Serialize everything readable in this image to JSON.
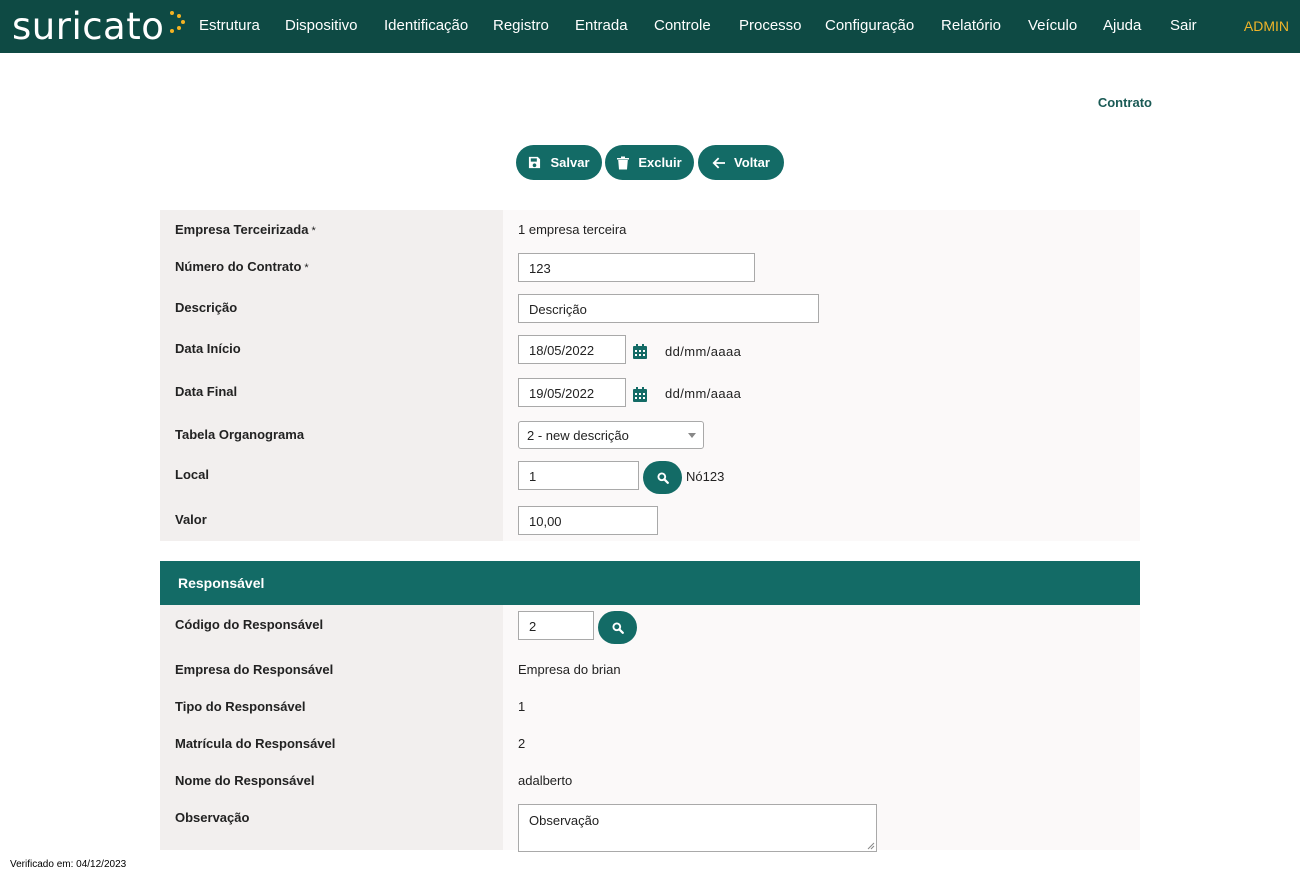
{
  "brand": {
    "logo_text": "suricato"
  },
  "nav": {
    "items": [
      "Estrutura",
      "Dispositivo",
      "Identificação",
      "Registro",
      "Entrada",
      "Controle",
      "Processo",
      "Configuração",
      "Relatório",
      "Veículo",
      "Ajuda",
      "Sair"
    ],
    "user": "ADMIN"
  },
  "page": {
    "title": "Contrato"
  },
  "actions": {
    "save": "Salvar",
    "delete": "Excluir",
    "back": "Voltar"
  },
  "form": {
    "empresa_label": "Empresa Terceirizada",
    "empresa_value": "1 empresa terceira",
    "numero_label": "Número do Contrato",
    "numero_value": "123",
    "descricao_label": "Descrição",
    "descricao_value": "Descrição",
    "inicio_label": "Data Início",
    "inicio_value": "18/05/2022",
    "final_label": "Data Final",
    "final_value": "19/05/2022",
    "date_hint": "dd/mm/aaaa",
    "organograma_label": "Tabela Organograma",
    "organograma_value": "2 - new descrição",
    "local_label": "Local",
    "local_value": "1",
    "local_name": "Nó123",
    "valor_label": "Valor",
    "valor_value": "10,00",
    "required_mark": "*"
  },
  "responsavel": {
    "section_title": "Responsável",
    "codigo_label": "Código do Responsável",
    "codigo_value": "2",
    "empresa_label": "Empresa do Responsável",
    "empresa_value": "Empresa do brian",
    "tipo_label": "Tipo do Responsável",
    "tipo_value": "1",
    "matricula_label": "Matrícula do Responsável",
    "matricula_value": "2",
    "nome_label": "Nome do Responsável",
    "nome_value": "adalberto",
    "observacao_label": "Observação",
    "observacao_value": "Observação"
  },
  "footer": {
    "verified": "Verificado em: 04/12/2023"
  },
  "colors": {
    "navbar": "#0e4a44",
    "accent": "#136b66",
    "admin": "#f0b429",
    "logo_dots": "#f5b323"
  },
  "icons": {
    "save": "floppy-icon",
    "delete": "trash-icon",
    "back": "arrow-left-icon",
    "calendar": "calendar-icon",
    "search": "search-icon"
  }
}
